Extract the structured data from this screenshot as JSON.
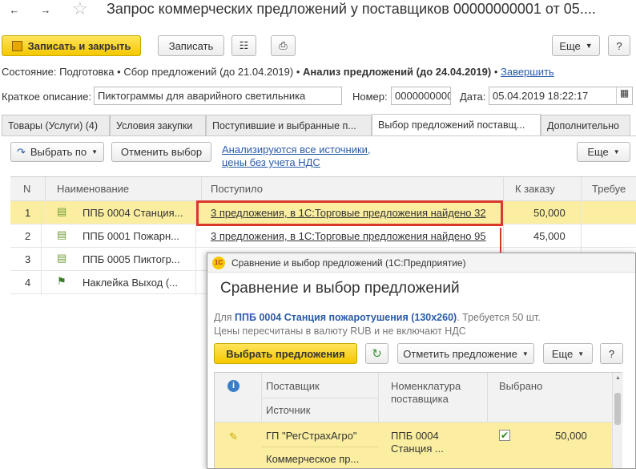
{
  "window": {
    "title": "Запрос коммерческих предложений у поставщиков 00000000001 от 05...."
  },
  "toolbar": {
    "save_close": "Записать и закрыть",
    "save": "Записать",
    "more": "Еще",
    "help": "?"
  },
  "status": {
    "prefix": "Состояние:",
    "s1": "Подготовка",
    "s2": "Сбор предложений (до 21.04.2019)",
    "s3": "Анализ предложений (до 24.04.2019)",
    "finish": "Завершить"
  },
  "form": {
    "desc_label": "Краткое описание:",
    "desc_value": "Пиктограммы для аварийного светильника",
    "num_label": "Номер:",
    "num_value": "0000000000",
    "date_label": "Дата:",
    "date_value": "05.04.2019 18:22:17"
  },
  "tabs": [
    "Товары (Услуги) (4)",
    "Условия закупки",
    "Поступившие и выбранные п...",
    "Выбор предложений поставщ...",
    "Дополнительно"
  ],
  "sub_toolbar": {
    "select_by": "Выбрать по",
    "cancel_select": "Отменить выбор",
    "analysis_link": "Анализируются все источники, цены без учета НДС",
    "more": "Еще"
  },
  "table": {
    "headers": [
      "N",
      "Наименование",
      "Поступило",
      "К заказу",
      "Требуе"
    ],
    "rows": [
      {
        "n": "1",
        "name": "ППБ 0004 Станция...",
        "received": "3 предложения, в 1С:Торговые предложения найдено 32",
        "qty": "50,000"
      },
      {
        "n": "2",
        "name": "ППБ 0001 Пожарн...",
        "received": "3 предложения, в 1С:Торговые предложения найдено 95",
        "qty": "45,000"
      },
      {
        "n": "3",
        "name": "ППБ 0005 Пиктогр...",
        "received": "",
        "qty": ""
      },
      {
        "n": "4",
        "name": "Наклейка Выход (...",
        "received": "",
        "qty": ""
      }
    ]
  },
  "dialog": {
    "window_title": "Сравнение и выбор предложений  (1С:Предприятие)",
    "logo": "1С",
    "heading": "Сравнение и выбор предложений",
    "info_prefix": "Для ",
    "info_item": "ППБ 0004 Станция пожаротушения (130x260)",
    "info_rest": ". Требуется 50 шт. Цены пересчитаны в валюту RUB и не включают НДС",
    "select_btn": "Выбрать предложения",
    "mark_btn": "Отметить предложение",
    "more": "Еще",
    "help": "?",
    "headers": {
      "info": "i",
      "supplier": "Поставщик",
      "source": "Источник",
      "nomenclature": "Номенклатура поставщика",
      "selected": "Выбрано"
    },
    "row": {
      "supplier": "ГП \"РегСтрахАгро\"",
      "source": "Коммерческое пр...",
      "nomenclature": "ППБ 0004 Станция ...",
      "qty": "50,000"
    }
  },
  "colors": {
    "accent_yellow": "#f5c800",
    "row_highlight": "#fbeea0",
    "red_frame": "#d9382b",
    "link_blue": "#2a5ba8"
  }
}
